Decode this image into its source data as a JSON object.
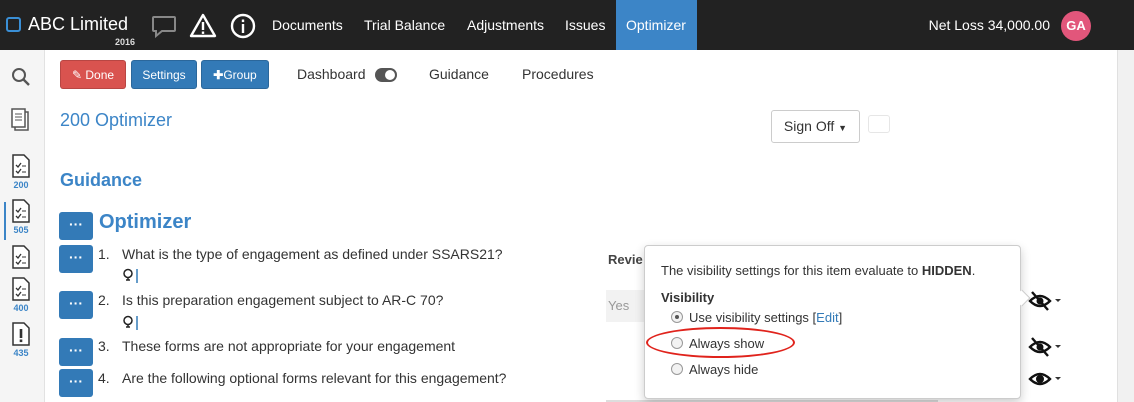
{
  "app": {
    "name": "ABC Limited",
    "year": "2016"
  },
  "nav": {
    "items": [
      "Documents",
      "Trial Balance",
      "Adjustments",
      "Issues",
      "Optimizer"
    ],
    "active": "Optimizer"
  },
  "header": {
    "net_loss": "Net Loss 34,000.00",
    "avatar_initials": "GA"
  },
  "sidebar": {
    "items": [
      {
        "icon": "search-icon",
        "label": ""
      },
      {
        "icon": "document-icon",
        "label": ""
      },
      {
        "icon": "checklist-icon",
        "label": "200"
      },
      {
        "icon": "checklist-icon",
        "label": "505"
      },
      {
        "icon": "checklist-icon",
        "label": ""
      },
      {
        "icon": "checklist-icon",
        "label": "400"
      },
      {
        "icon": "alert-doc-icon",
        "label": "435"
      }
    ]
  },
  "toolbar": {
    "done_label": "Done",
    "settings_label": "Settings",
    "group_label": "Group",
    "dashboard_label": "Dashboard",
    "guidance_label": "Guidance",
    "procedures_label": "Procedures"
  },
  "page": {
    "title": "200 Optimizer",
    "sign_off_label": "Sign Off",
    "guidance_heading": "Guidance",
    "section_heading": "Optimizer"
  },
  "questions": [
    {
      "num": "1.",
      "text": "What is the type of engagement as defined under SSARS21?"
    },
    {
      "num": "2.",
      "text": "Is this preparation engagement subject to AR-C 70?"
    },
    {
      "num": "3.",
      "text": "These forms are not appropriate for your engagement"
    },
    {
      "num": "4.",
      "text": "Are the following optional forms relevant for this engagement?"
    }
  ],
  "table": {
    "header": "Revie",
    "row1_value": "Yes"
  },
  "popover": {
    "message_prefix": "The visibility settings for this item evaluate to ",
    "message_value": "HIDDEN",
    "message_suffix": ".",
    "section_label": "Visibility",
    "options": {
      "use_settings": "Use visibility settings",
      "edit_link": "Edit",
      "always_show": "Always show",
      "always_hide": "Always hide"
    },
    "selected": "use_settings"
  },
  "colors": {
    "nav_bg": "#222222",
    "active_tab": "#3c85c7",
    "primary": "#337ab7",
    "danger": "#d9534f",
    "avatar": "#e2567b",
    "highlight": "#e0231c"
  }
}
